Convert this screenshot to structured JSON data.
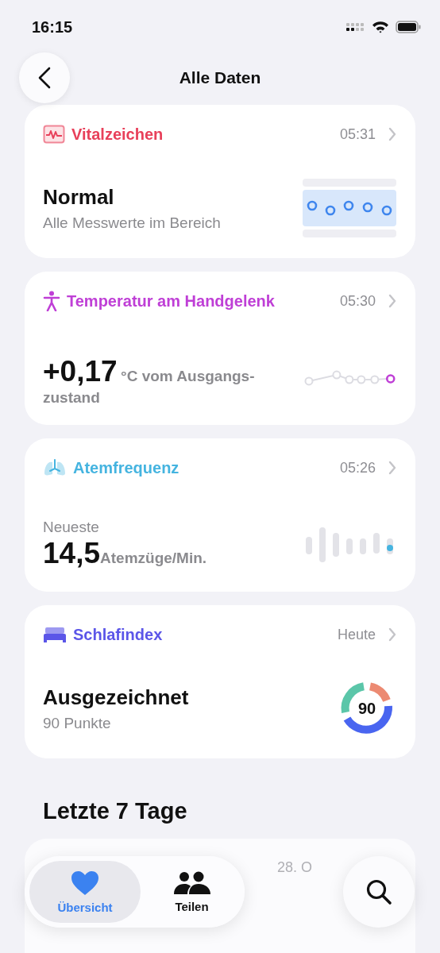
{
  "status_bar": {
    "time": "16:15"
  },
  "nav": {
    "title": "Alle Daten"
  },
  "cards": [
    {
      "kind": "vitals",
      "title": "Vitalzeichen",
      "color": "#e8405a",
      "time": "05:31",
      "value": "Normal",
      "detail": "Alle Messwerte im Bereich"
    },
    {
      "kind": "temperature",
      "title": "Temperatur am Handgelenk",
      "color": "#bf3fd6",
      "time": "05:30",
      "value": "+0,17",
      "unit": "°C vom Ausgangs-zustand"
    },
    {
      "kind": "respiration",
      "title": "Atemfrequenz",
      "color": "#45b4e0",
      "time": "05:26",
      "label": "Neueste",
      "value": "14,5",
      "unit": "Atemzüge/Min."
    },
    {
      "kind": "sleep",
      "title": "Schlafindex",
      "color": "#5b55e8",
      "time": "Heute",
      "value": "Ausgezeichnet",
      "detail": "90 Punkte",
      "score": "90"
    }
  ],
  "section": {
    "title": "Letzte 7 Tage",
    "partial_card": {
      "time": "28. O"
    }
  },
  "tab_bar": {
    "tabs": [
      {
        "label": "Übersicht",
        "selected": true
      },
      {
        "label": "Teilen",
        "selected": false
      }
    ]
  }
}
